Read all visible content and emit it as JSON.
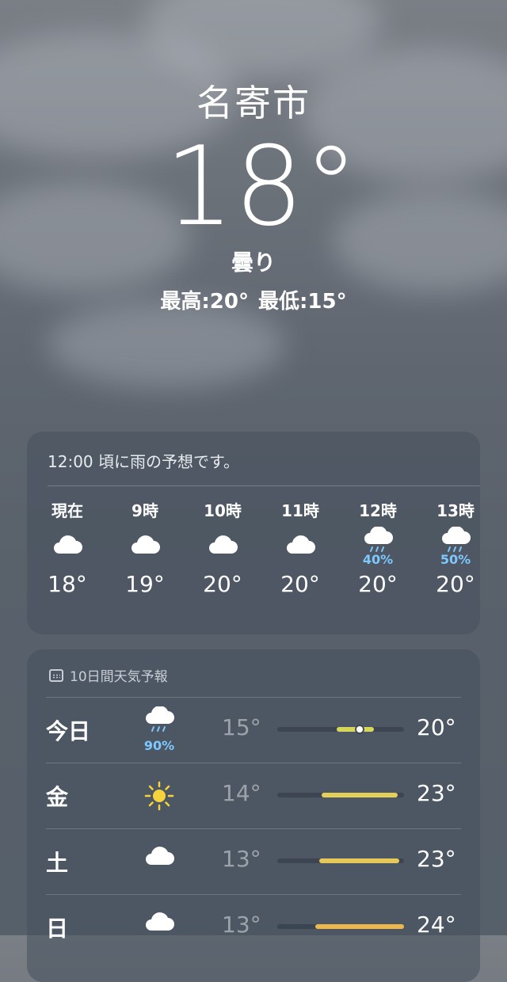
{
  "header": {
    "city": "名寄市",
    "temperature": "18°",
    "condition": "曇り",
    "high": "最高:20°",
    "low": "最低:15°"
  },
  "hourly": {
    "summary": "12:00 頃に雨の予想です。",
    "items": [
      {
        "label": "現在",
        "icon": "cloud-icon",
        "precip": "",
        "temp": "18°"
      },
      {
        "label": "9時",
        "icon": "cloud-icon",
        "precip": "",
        "temp": "19°"
      },
      {
        "label": "10時",
        "icon": "cloud-icon",
        "precip": "",
        "temp": "20°"
      },
      {
        "label": "11時",
        "icon": "cloud-icon",
        "precip": "",
        "temp": "20°"
      },
      {
        "label": "12時",
        "icon": "cloud-rain-icon",
        "precip": "40%",
        "temp": "20°"
      },
      {
        "label": "13時",
        "icon": "cloud-rain-icon",
        "precip": "50%",
        "temp": "20°"
      }
    ]
  },
  "daily": {
    "title": "10日間天気予報",
    "rows": [
      {
        "day": "今日",
        "icon": "cloud-rain-icon",
        "precip": "90%",
        "low": "15°",
        "high": "20°",
        "range_start": 0.47,
        "range_end": 0.76,
        "current": 0.65,
        "color": "#d6d75a"
      },
      {
        "day": "金",
        "icon": "sun-icon",
        "precip": "",
        "low": "14°",
        "high": "23°",
        "range_start": 0.35,
        "range_end": 0.95,
        "current": null,
        "color": "#e4cf5a"
      },
      {
        "day": "土",
        "icon": "cloud-icon",
        "precip": "",
        "low": "13°",
        "high": "23°",
        "range_start": 0.33,
        "range_end": 0.96,
        "current": null,
        "color": "#e6c85a"
      },
      {
        "day": "日",
        "icon": "cloud-icon",
        "precip": "",
        "low": "13°",
        "high": "24°",
        "range_start": 0.3,
        "range_end": 1.0,
        "current": null,
        "color": "#ecb84e"
      }
    ]
  },
  "colors": {
    "precip": "#7ec8ff",
    "sun": "#f5d33b"
  }
}
